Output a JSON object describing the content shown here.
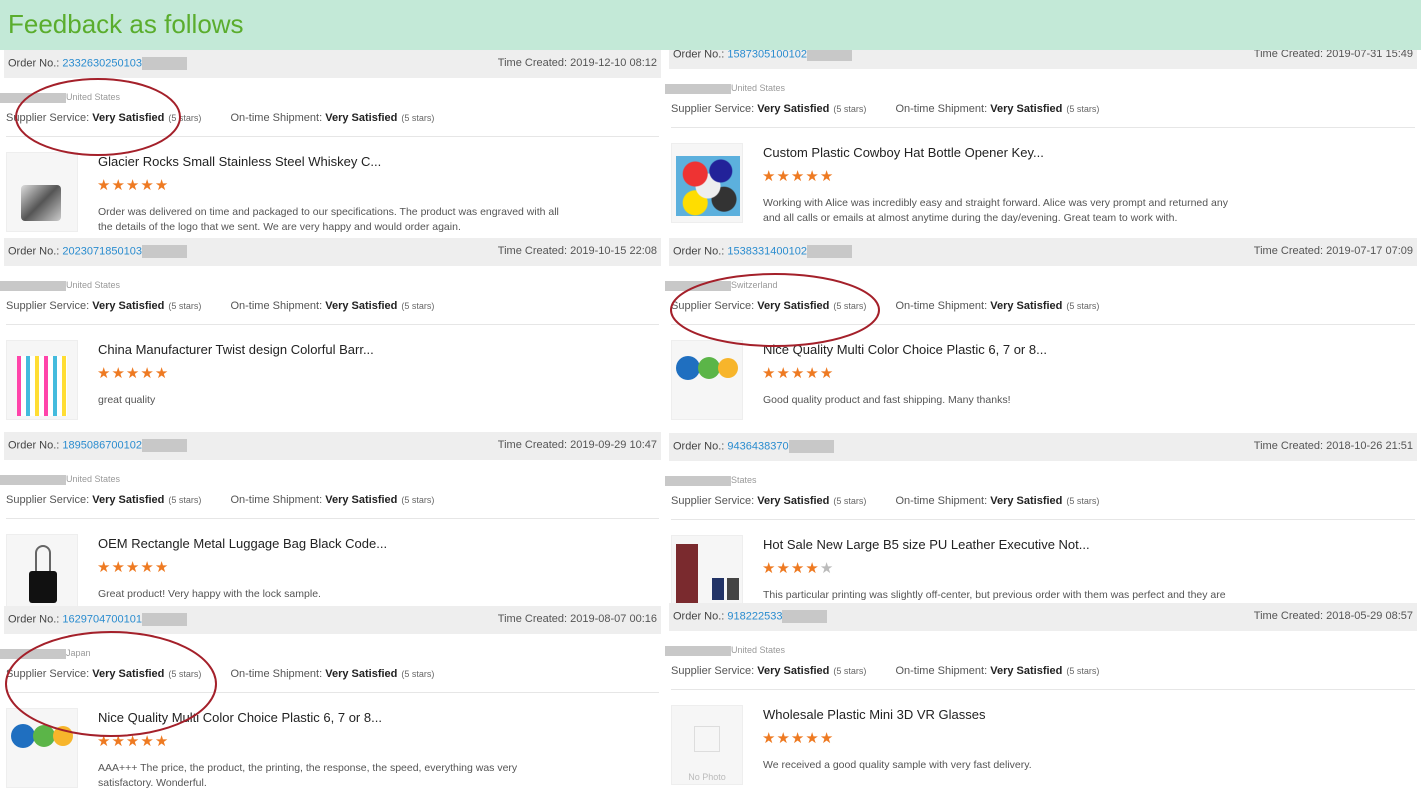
{
  "header": {
    "title": "Feedback as follows"
  },
  "labels": {
    "order_no": "Order No.:",
    "time_created": "Time Created:",
    "supplier_service": "Supplier Service:",
    "ontime_shipment": "On-time Shipment:",
    "no_photo": "No Photo"
  },
  "accent_color": "#ee7a22",
  "annotation_color": "#a4202a",
  "left": [
    {
      "order_no": "2332630250103",
      "time": "2019-12-10 08:12",
      "country": "United States",
      "supplier": "Very Satisfied",
      "supplier_stars": "(5 stars)",
      "shipment": "Very Satisfied",
      "shipment_stars": "(5 stars)",
      "product": "Glacier Rocks Small Stainless Steel Whiskey C...",
      "rating": 5,
      "comment": "Order was delivered on time and packaged to our specifications. The product was engraved with all the details of the logo that we sent. We are very happy and would order again.",
      "image": "steel-cubes"
    },
    {
      "order_no": "2023071850103",
      "time": "2019-10-15 22:08",
      "country": "United States",
      "supplier": "Very Satisfied",
      "supplier_stars": "(5 stars)",
      "shipment": "Very Satisfied",
      "shipment_stars": "(5 stars)",
      "product": "China Manufacturer Twist design Colorful Barr...",
      "rating": 5,
      "comment": "great quality",
      "image": "pens"
    },
    {
      "order_no": "1895086700102",
      "time": "2019-09-29 10:47",
      "country": "United States",
      "supplier": "Very Satisfied",
      "supplier_stars": "(5 stars)",
      "shipment": "Very Satisfied",
      "shipment_stars": "(5 stars)",
      "product": "OEM Rectangle Metal Luggage Bag Black Code...",
      "rating": 5,
      "comment": "Great product! Very happy with the lock sample.",
      "image": "lock"
    },
    {
      "order_no": "1629704700101",
      "time": "2019-08-07 00:16",
      "country": "Japan",
      "supplier": "Very Satisfied",
      "supplier_stars": "(5 stars)",
      "shipment": "Very Satisfied",
      "shipment_stars": "(5 stars)",
      "product": "Nice Quality Multi Color Choice Plastic 6, 7 or 8...",
      "rating": 5,
      "comment": "AAA+++ The price, the product, the printing, the response, the speed, everything was very satisfactory. Wonderful.",
      "image": "color-discs"
    }
  ],
  "right": [
    {
      "order_no": "1587305100102",
      "time": "2019-07-31 15:49",
      "country": "United States",
      "supplier": "Very Satisfied",
      "supplier_stars": "(5 stars)",
      "shipment": "Very Satisfied",
      "shipment_stars": "(5 stars)",
      "product": "Custom Plastic Cowboy Hat Bottle Opener Key...",
      "rating": 5,
      "comment": "Working with Alice was incredibly easy and straight forward. Alice was very prompt and returned any and all calls or emails at almost anytime during the day/evening. Great team to work with.",
      "image": "hats"
    },
    {
      "order_no": "1538331400102",
      "time": "2019-07-17 07:09",
      "country": "Switzerland",
      "supplier": "Very Satisfied",
      "supplier_stars": "(5 stars)",
      "shipment": "Very Satisfied",
      "shipment_stars": "(5 stars)",
      "product": "Nice Quality Multi Color Choice Plastic 6, 7 or 8...",
      "rating": 5,
      "comment": "Good quality product and fast shipping. Many thanks!",
      "image": "color-discs"
    },
    {
      "order_no": "9436438370",
      "time": "2018-10-26 21:51",
      "country": "States",
      "supplier": "Very Satisfied",
      "supplier_stars": "(5 stars)",
      "shipment": "Very Satisfied",
      "shipment_stars": "(5 stars)",
      "product": "Hot Sale New Large B5 size PU Leather Executive Not...",
      "rating": 4,
      "comment": "This particular printing was slightly off-center, but previous order with them was perfect and they are honest and nice to deal with- highly recommended.",
      "image": "notebooks"
    },
    {
      "order_no": "918222533",
      "time": "2018-05-29 08:57",
      "country": "United States",
      "supplier": "Very Satisfied",
      "supplier_stars": "(5 stars)",
      "shipment": "Very Satisfied",
      "shipment_stars": "(5 stars)",
      "product": "Wholesale Plastic Mini 3D VR Glasses",
      "rating": 5,
      "comment": "We received a good quality sample with very fast delivery.",
      "image": "no-photo"
    }
  ]
}
